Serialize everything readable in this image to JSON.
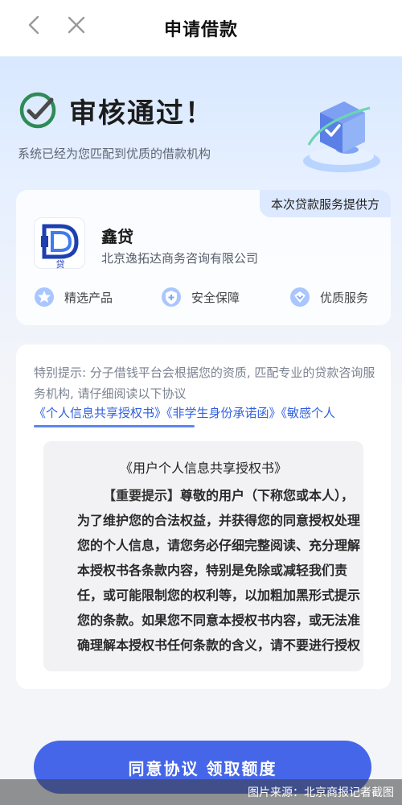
{
  "navbar": {
    "title": "申请借款"
  },
  "status": {
    "title": "审核通过！",
    "subtitle": "系统已经为您匹配到优质的借款机构"
  },
  "provider": {
    "tag": "本次贷款服务提供方",
    "logo_text": "贷",
    "name": "鑫贷",
    "company": "北京逸拓达商务咨询有限公司",
    "features": [
      "精选产品",
      "安全保障",
      "优质服务"
    ]
  },
  "agreement": {
    "notice": "特别提示: 分子借钱平台会根据您的资质, 匹配专业的贷款咨询服务机构, 请仔细阅读以下协议",
    "links": [
      "《个人信息共享授权书》",
      "《非学生身份承诺函》",
      "《敏感个人"
    ],
    "doc_title": "《用户个人信息共享授权书》",
    "doc_tag": "【重要提示】",
    "doc_body": "尊敬的用户（下称您或本人），为了维护您的合法权益，并获得您的同意授权处理您的个人信息，请您务必仔细完整阅读、充分理解本授权书各条款内容，特别是免除或减轻我们责任，或可能限制您的权利等，以加粗加黑形式提示您的条款。如果您不同意本授权书内容，或无法准确理解本授权书任何条款的含义，请不要进行授权"
  },
  "cta": {
    "label": "同意协议 领取额度"
  },
  "watermark": {
    "text": "图片来源：北京商报记者截图"
  },
  "colors": {
    "primary": "#4566e8",
    "link": "#2f5fe0",
    "check": "#2e8b57"
  }
}
